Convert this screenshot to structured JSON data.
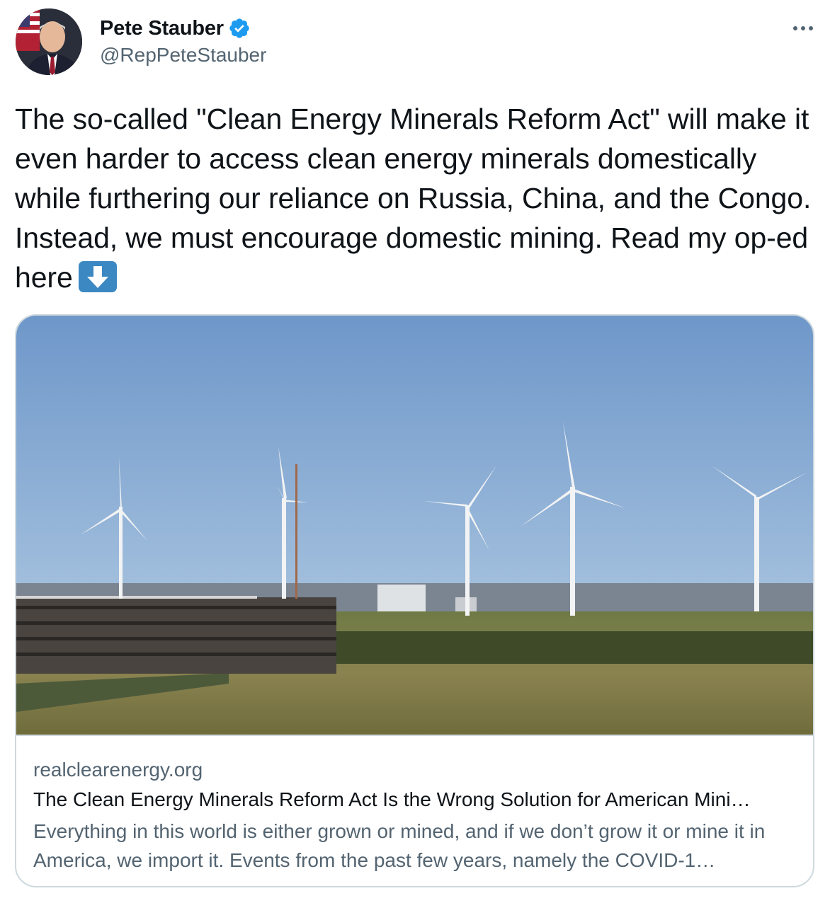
{
  "author": {
    "display_name": "Pete Stauber",
    "handle": "@RepPeteStauber",
    "verified": true,
    "avatar_icon": "profile-photo"
  },
  "tweet": {
    "text": "The so-called \"Clean Energy Minerals Reform Act\" will make it even harder to access clean energy minerals domestically while furthering our reliance on Russia, China, and the Congo. Instead, we must encourage domestic mining. Read my op-ed here",
    "emoji": "down-arrow-emoji"
  },
  "card": {
    "image_icon": "wind-turbines-photo",
    "domain": "realclearenergy.org",
    "title": "The Clean Energy Minerals Reform Act Is the Wrong Solution for American Mini…",
    "description": "Everything in this world is either grown or mined, and if we don’t grow it or mine it in America, we import it. Events from the past few years, namely the COVID-1…"
  },
  "colors": {
    "text_primary": "#0f1419",
    "text_secondary": "#536471",
    "verified_blue": "#1d9bf0",
    "card_border": "#cfd9de",
    "emoji_blue": "#3b88c3"
  }
}
